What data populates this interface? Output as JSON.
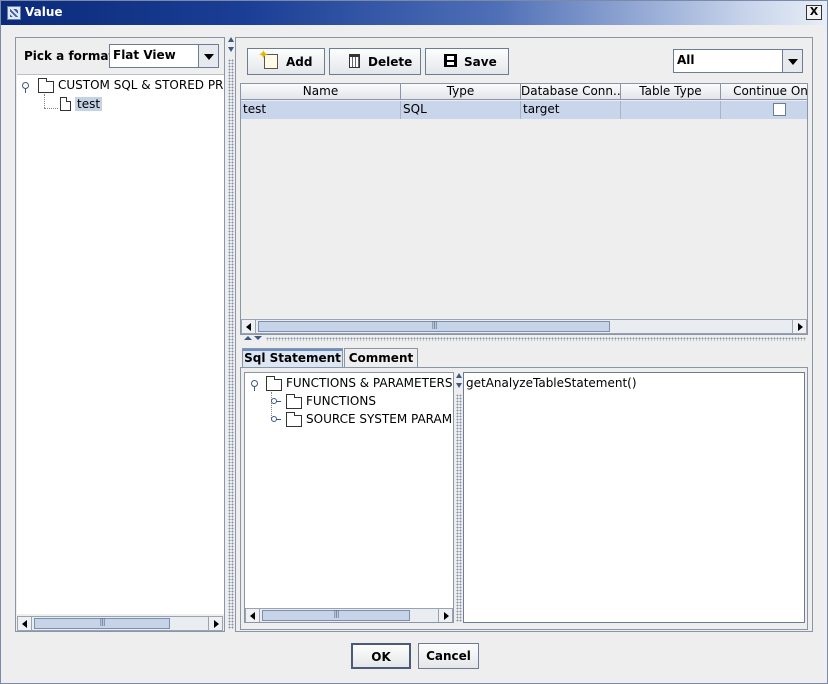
{
  "window": {
    "title": "Value",
    "close_label": "X"
  },
  "left": {
    "pick_label": "Pick a format",
    "format_value": "Flat View",
    "tree": {
      "root_label": "CUSTOM SQL & STORED PROC",
      "child_label": "test"
    }
  },
  "toolbar": {
    "add_label": "Add",
    "delete_label": "Delete",
    "save_label": "Save",
    "filter_value": "All"
  },
  "table": {
    "columns": [
      "Name",
      "Type",
      "Database Conn...",
      "Table Type",
      "Continue On"
    ],
    "rows": [
      {
        "name": "test",
        "type": "SQL",
        "db_conn": "target",
        "table_type": "",
        "continue_on": false
      }
    ]
  },
  "tabs": {
    "sql_label": "Sql Statement",
    "comment_label": "Comment"
  },
  "sql_tree": {
    "root_label": "FUNCTIONS & PARAMETERS",
    "items": [
      "FUNCTIONS",
      "SOURCE SYSTEM PARAM"
    ]
  },
  "statement": {
    "text": "getAnalyzeTableStatement()"
  },
  "footer": {
    "ok_label": "OK",
    "cancel_label": "Cancel"
  }
}
